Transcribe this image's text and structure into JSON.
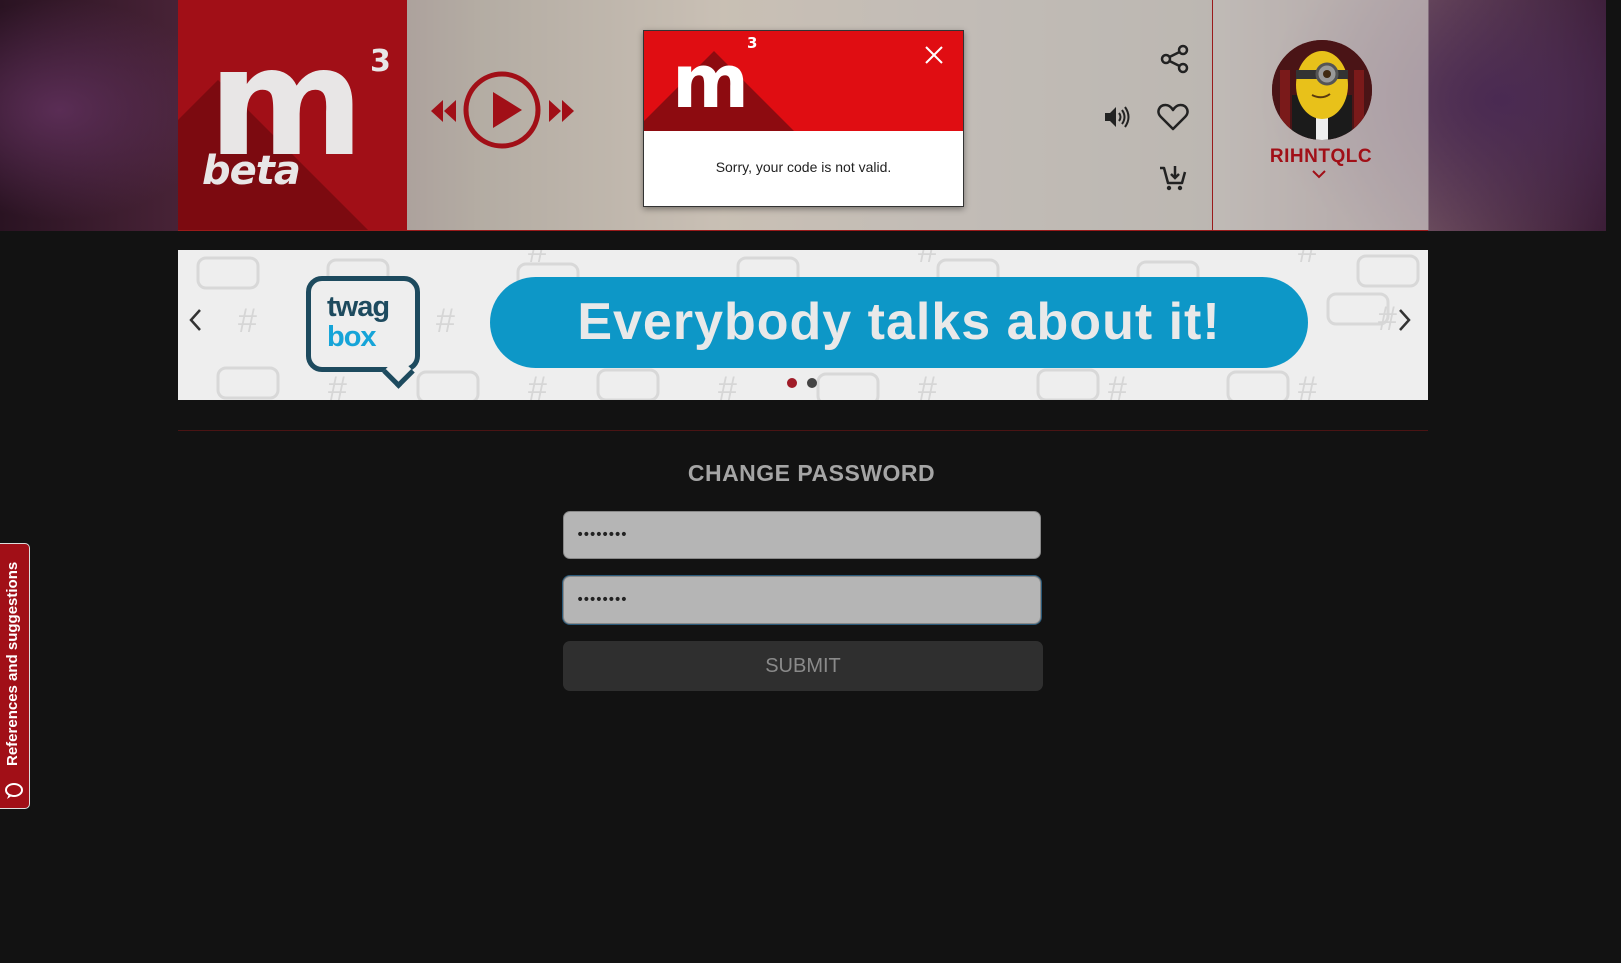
{
  "header": {
    "logo_sup": "3",
    "logo_m": "m",
    "logo_beta": "beta",
    "icons": {
      "rewind": "rewind-icon",
      "play": "play-icon",
      "fast_forward": "fast-forward-icon",
      "share": "share-icon",
      "volume": "volume-icon",
      "favorite": "heart-icon",
      "add_to_cart": "cart-add-icon"
    },
    "user": {
      "name": "RIHNTQLC",
      "menu_icon": "chevron-down-icon"
    }
  },
  "modal": {
    "logo_m": "m",
    "logo_sup": "3",
    "message": "Sorry, your code is not valid.",
    "close_icon": "close-icon"
  },
  "banner": {
    "brand_line1": "twag",
    "brand_line2": "box",
    "headline": "Everybody talks about it!",
    "slide_count": 2,
    "active_slide": 1,
    "colors": {
      "pill": "#0d97c7",
      "dot_active": "#a01c28",
      "dot_inactive": "#444444"
    }
  },
  "form": {
    "title": "CHANGE PASSWORD",
    "password_value": "••••••••",
    "confirm_value": "••••••••",
    "submit_label": "SUBMIT"
  },
  "side_tab": {
    "label": "References and suggestions",
    "icon": "feedback-icon"
  },
  "colors": {
    "brand_red": "#a10f17",
    "modal_red": "#e00d12",
    "page_bg": "#121212"
  }
}
